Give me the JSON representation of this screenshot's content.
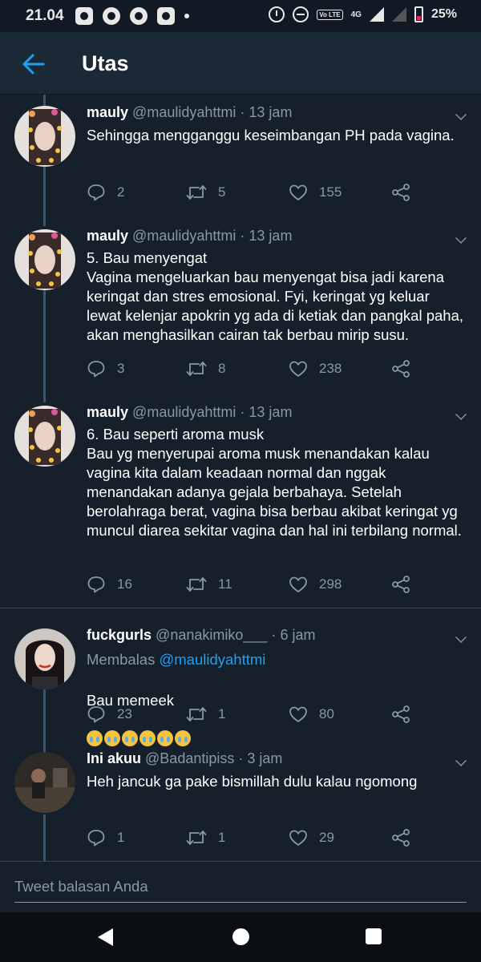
{
  "status_bar": {
    "time": "21.04",
    "network": "4G",
    "volte": "Vo LTE",
    "battery": "25%"
  },
  "header": {
    "title": "Utas",
    "back_icon": "arrow-left-icon"
  },
  "tweets": [
    {
      "name": "mauly",
      "handle": "@maulidyahttmi",
      "time": "13 jam",
      "text": "Sehingga mengganggu keseimbangan PH pada vagina.",
      "replies": "2",
      "retweets": "5",
      "likes": "155"
    },
    {
      "name": "mauly",
      "handle": "@maulidyahttmi",
      "time": "13 jam",
      "text": "5. Bau menyengat\nVagina mengeluarkan bau menyengat bisa jadi karena keringat dan stres emosional. Fyi, keringat yg keluar lewat kelenjar apokrin yg ada di ketiak dan pangkal paha, akan menghasilkan cairan tak berbau mirip susu.",
      "replies": "3",
      "retweets": "8",
      "likes": "238"
    },
    {
      "name": "mauly",
      "handle": "@maulidyahttmi",
      "time": "13 jam",
      "text": "6. Bau seperti aroma musk\nBau yg menyerupai aroma musk menandakan kalau vagina kita dalam keadaan normal dan nggak menandakan adanya gejala berbahaya. Setelah berolahraga berat, vagina bisa berbau akibat keringat yg muncul diarea sekitar vagina dan hal ini terbilang normal.",
      "replies": "16",
      "retweets": "11",
      "likes": "298"
    },
    {
      "name": "fuckgurls",
      "handle": "@nanakimiko___",
      "time": "6 jam",
      "reply_prefix": "Membalas",
      "reply_mention": "@maulidyahttmi",
      "text": "Bau memeek",
      "emoji": "loudly-crying-face-emoji",
      "replies": "23",
      "retweets": "1",
      "likes": "80"
    },
    {
      "name": "Ini akuu",
      "handle": "@Badantipiss",
      "time": "3 jam",
      "text": "Heh jancuk ga pake bismillah dulu kalau ngomong",
      "replies": "1",
      "retweets": "1",
      "likes": "29"
    }
  ],
  "reply_box": {
    "placeholder": "Tweet balasan Anda"
  },
  "colors": {
    "background": "#15202b",
    "header": "#1b2836",
    "accent": "#1da1f2",
    "muted": "#8899a6"
  }
}
